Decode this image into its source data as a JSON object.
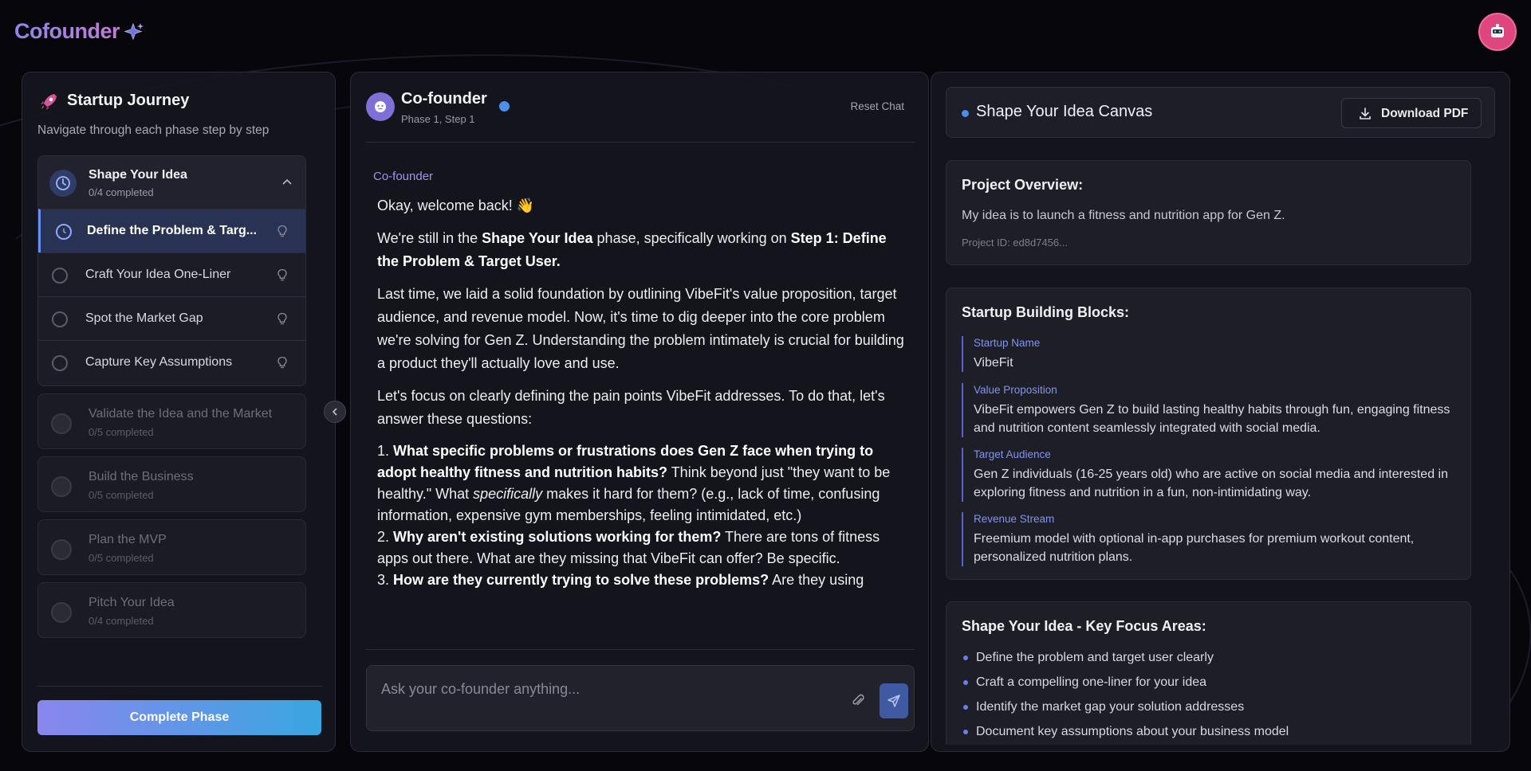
{
  "header": {
    "logo_text": "Cofounder"
  },
  "sidebar": {
    "title": "Startup Journey",
    "subtitle": "Navigate through each phase step by step",
    "open_phase": {
      "name": "Shape Your Idea",
      "count": "0/4 completed",
      "steps": [
        {
          "label": "Define the Problem & Targ...",
          "active": true
        },
        {
          "label": "Craft Your Idea One-Liner",
          "active": false
        },
        {
          "label": "Spot the Market Gap",
          "active": false
        },
        {
          "label": "Capture Key Assumptions",
          "active": false
        }
      ]
    },
    "phases": [
      {
        "name": "Validate the Idea and the Market",
        "count": "0/5 completed"
      },
      {
        "name": "Build the Business",
        "count": "0/5 completed"
      },
      {
        "name": "Plan the MVP",
        "count": "0/5 completed"
      },
      {
        "name": "Pitch Your Idea",
        "count": "0/4 completed"
      }
    ],
    "complete_button": "Complete Phase"
  },
  "chat": {
    "title": "Co-founder",
    "subtitle": "Phase 1, Step 1",
    "reset_label": "Reset Chat",
    "sender": "Co-founder",
    "input_placeholder": "Ask your co-founder anything...",
    "message": {
      "greeting": "Okay, welcome back! 👋",
      "p1_a": "We're still in the ",
      "p1_b": "Shape Your Idea",
      "p1_c": " phase, specifically working on ",
      "p1_d": "Step 1: Define the Problem & Target User.",
      "p2": "Last time, we laid a solid foundation by outlining VibeFit's value proposition, target audience, and revenue model. Now, it's time to dig deeper into the core problem we're solving for Gen Z. Understanding the problem intimately is crucial for building a product they'll actually love and use.",
      "p3": "Let's focus on clearly defining the pain points VibeFit addresses. To do that, let's answer these questions:",
      "q1_num": "1. ",
      "q1_b": "What specific problems or frustrations does Gen Z face when trying to adopt healthy fitness and nutrition habits?",
      "q1_a": " Think beyond just \"they want to be healthy.\" What ",
      "q1_i": "specifically",
      "q1_c": " makes it hard for them? (e.g., lack of time, confusing information, expensive gym memberships, feeling intimidated, etc.)",
      "q2_num": "2. ",
      "q2_b": "Why aren't existing solutions working for them?",
      "q2_a": " There are tons of fitness apps out there. What are they missing that VibeFit can offer? Be specific.",
      "q3_num": "3. ",
      "q3_b": "How are they currently trying to solve these problems?",
      "q3_a": " Are they using"
    }
  },
  "canvas": {
    "title": "Shape Your Idea Canvas",
    "download_label": "Download PDF",
    "overview": {
      "title": "Project Overview:",
      "text": "My idea is to launch a fitness and nutrition app for Gen Z.",
      "id": "Project ID: ed8d7456..."
    },
    "blocks": {
      "title": "Startup Building Blocks:",
      "items": [
        {
          "label": "Startup Name",
          "value": "VibeFit"
        },
        {
          "label": "Value Proposition",
          "value": "VibeFit empowers Gen Z to build lasting healthy habits through fun, engaging fitness and nutrition content seamlessly integrated with social media."
        },
        {
          "label": "Target Audience",
          "value": "Gen Z individuals (16-25 years old) who are active on social media and interested in exploring fitness and nutrition in a fun, non-intimidating way."
        },
        {
          "label": "Revenue Stream",
          "value": "Freemium model with optional in-app purchases for premium workout content, personalized nutrition plans."
        }
      ]
    },
    "focus": {
      "title": "Shape Your Idea - Key Focus Areas:",
      "items": [
        "Define the problem and target user clearly",
        "Craft a compelling one-liner for your idea",
        "Identify the market gap your solution addresses",
        "Document key assumptions about your business model"
      ]
    }
  },
  "colors": {
    "accent": "#6a8ef5",
    "brand_gradient_start": "#8a86ee",
    "brand_gradient_end": "#38a6e0",
    "avatar": "#e0467e"
  }
}
